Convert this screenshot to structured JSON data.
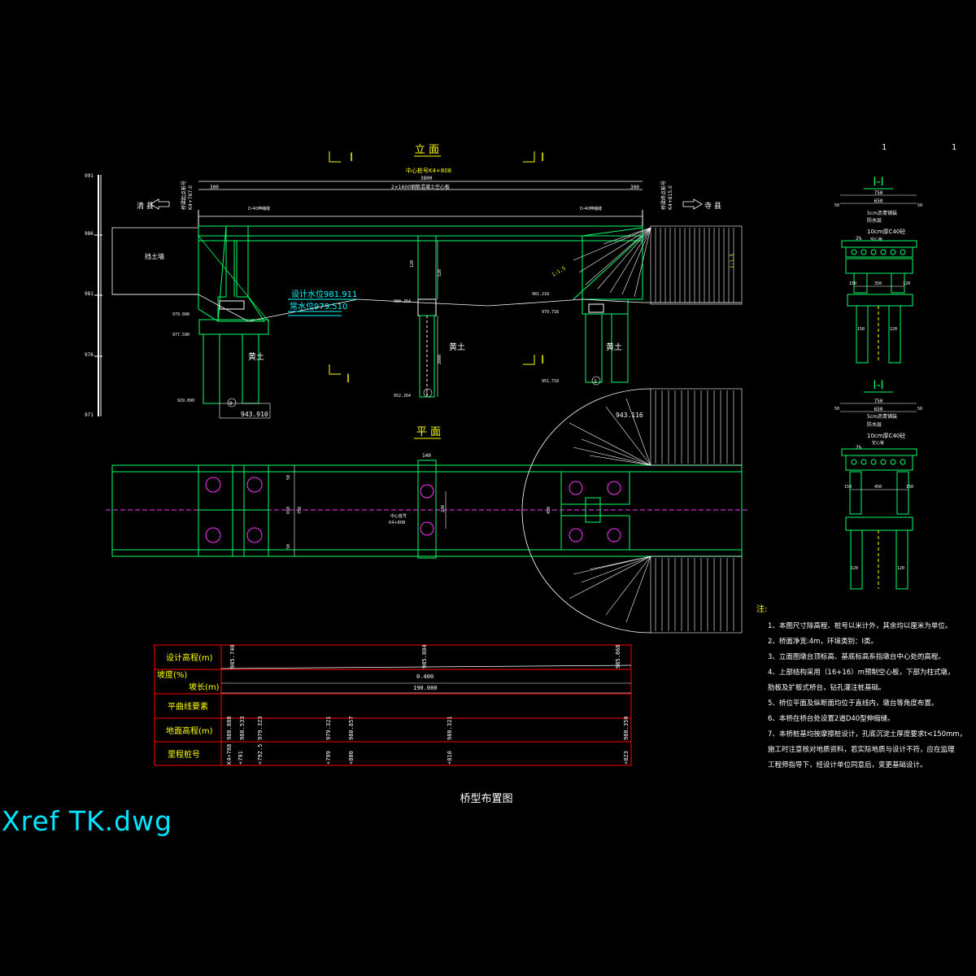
{
  "drawing": {
    "main_title": "桥型布置图",
    "xref_label": "Xref TK.dwg",
    "corner_marks": [
      "1",
      "1"
    ],
    "colors": {
      "background": "#000000",
      "structure": "#00ff66",
      "white": "#ffffff",
      "dimension": "#ffffff",
      "yellow": "#ffff00",
      "cyan": "#00ffff",
      "magenta": "#ff33ff",
      "red_table": "#ff0000"
    }
  },
  "elevation": {
    "title": "立 面",
    "section_mark": "I",
    "center_pile": "中心桩号K4+808",
    "total_span": "3800",
    "left_span_dim": "300",
    "right_span_dim": "300",
    "span_text": "2×1600钢筋混凝土空心板",
    "left_station": "K4+787.0",
    "left_station_label": "桥梁起点桩号",
    "right_station": "K4+815.0",
    "right_station_label": "桥梁终点桩号",
    "left_direction": "清 县",
    "right_direction": "寺 县",
    "joint_left": "D-40伸缩缝",
    "joint_right": "D-40伸缩缝",
    "retaining_wall": "挡土墙",
    "design_water": "设计水位981.911",
    "normal_water": "常水位979.510",
    "soil": "黄土",
    "slope": "1:1.5",
    "slope_right": "1:1.5",
    "elev_scale": [
      "991",
      "986",
      "981",
      "976",
      "971"
    ],
    "left_marks": [
      "979.090",
      "977.590",
      "929.090"
    ],
    "mid_marks": [
      "980.264",
      "952.264"
    ],
    "right_marks": [
      "981.218",
      "979.718",
      "951.718"
    ],
    "bottom_left": "943.910",
    "bottom_right": "943.116",
    "pile_labels": [
      "0",
      "1",
      "2"
    ],
    "dims": [
      "120",
      "520",
      "150",
      "2000",
      "150",
      "880",
      "1800",
      "320",
      "150",
      "120",
      "120",
      "230",
      "300",
      "1800"
    ]
  },
  "plan": {
    "title": "平 面",
    "pier_width": "140",
    "width_dims": [
      "50",
      "650",
      "50",
      "750"
    ],
    "center_label": "中心桩号",
    "center_station": "K4+808",
    "pier_dim": "230",
    "right_dim": "450"
  },
  "section1": {
    "title": "I-I",
    "width": "750",
    "deck": "650",
    "side": "50",
    "layers": [
      "5cm沥青铺装",
      "防水层",
      "10cm厚C40砼",
      "空心板"
    ],
    "slope": "2%",
    "cap_dims": [
      "150",
      "120"
    ],
    "column_dims": [
      "150",
      "120"
    ],
    "spacing": "350",
    "bottom_dims": [
      "120"
    ]
  },
  "section2": {
    "title": "I-I",
    "width": "750",
    "deck": "650",
    "side": "50",
    "layers": [
      "5cm沥青铺装",
      "防水层",
      "10cm厚C40砼",
      "空心板"
    ],
    "slope": "2%",
    "spacing": "450",
    "dims": [
      "150",
      "150",
      "120",
      "120"
    ]
  },
  "profile_table": {
    "rows": [
      {
        "label": "设计高程(m)",
        "values": [
          "985.740",
          "985.804",
          "985.868"
        ]
      },
      {
        "label": "坡度(%)",
        "values": [
          "0.400"
        ]
      },
      {
        "label": "坡长(m)",
        "values": [
          "190.000"
        ]
      },
      {
        "label": "平曲线要素",
        "values": []
      },
      {
        "label": "地面高程(m)",
        "values": [
          "980.888",
          "980.533",
          "979.323",
          "979.321",
          "980.857",
          "980.321",
          "980.350"
        ]
      },
      {
        "label": "里程桩号",
        "values": [
          "K4+788",
          "+791",
          "+792.5",
          "+799",
          "+800",
          "+810",
          "+823"
        ]
      }
    ]
  },
  "notes": {
    "heading": "注:",
    "items": [
      "1、本图尺寸除高程、桩号以米计外，其余均以厘米为单位。",
      "2、桥面净宽:4m，环境类别：I类。",
      "3、立面图墩台顶标高、基底标高系指墩台中心处的高程。",
      "4、上部结构采用（16+16）m预制空心板，下部为柱式墩，",
      "   肋板及扩板式桥台，钻孔灌注桩基础。",
      "5、桥位平面及纵断面均位于直线内，墩台等角度布置。",
      "6、本桥在桥台处设置2道D40型伸缩缝。",
      "7、本桥桩基均按摩擦桩设计，孔底沉淀土厚度要求t<150mm，",
      "   施工时注意核对地质资料，若实际地质与设计不符，应在监理",
      "   工程师指导下，经设计单位同意后，变更基础设计。"
    ]
  }
}
